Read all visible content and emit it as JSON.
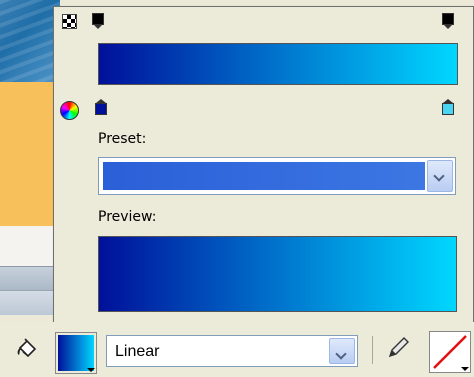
{
  "panel": {
    "preset_label": "Preset:",
    "preview_label": "Preview:"
  },
  "gradient": {
    "start_color": "#00109a",
    "end_color": "#00d7ff",
    "preset_color": "#2b5fd8"
  },
  "toolbar": {
    "fill_type_value": "Linear",
    "fill_icon": "paint-bucket-icon",
    "stroke_icon": "pencil-icon"
  }
}
